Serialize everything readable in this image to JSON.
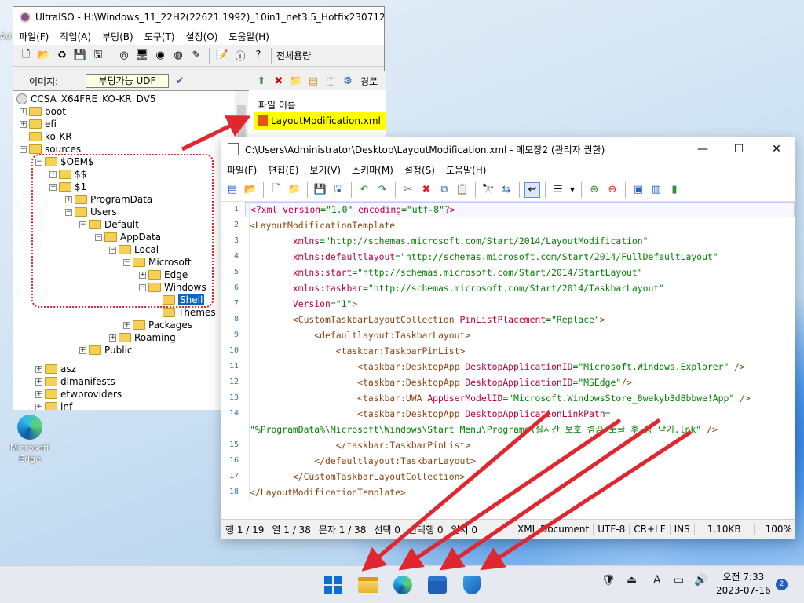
{
  "desktop": {
    "fragment": "Ad",
    "edge_icon_label": "Microsoft Edge"
  },
  "ultraiso": {
    "title": "UltraISO - H:\\Windows_11_22H2(22621.1992)_10in1_net3.5_Hotfix230712_Laun",
    "menu": [
      "파일(F)",
      "작업(A)",
      "부팅(B)",
      "도구(T)",
      "설정(O)",
      "도움말(H)"
    ],
    "toolbar_tail": "전체용량",
    "image_label": "이미지:",
    "image_type": "부팅가능 UDF",
    "right_header_label": "경로",
    "filename_header": "파일 이름",
    "selected_file": "LayoutModification.xml",
    "tree": [
      {
        "label": "CCSA_X64FRE_KO-KR_DV5",
        "icon": "cd"
      },
      {
        "label": "boot"
      },
      {
        "label": "efi"
      },
      {
        "label": "ko-KR"
      },
      {
        "label": "sources"
      },
      {
        "label": "$OEM$"
      },
      {
        "label": "$$"
      },
      {
        "label": "$1"
      },
      {
        "label": "ProgramData"
      },
      {
        "label": "Users"
      },
      {
        "label": "Default"
      },
      {
        "label": "AppData"
      },
      {
        "label": "Local"
      },
      {
        "label": "Microsoft"
      },
      {
        "label": "Edge"
      },
      {
        "label": "Windows"
      },
      {
        "label": "Shell"
      },
      {
        "label": "Themes"
      },
      {
        "label": "Packages"
      },
      {
        "label": "Roaming"
      },
      {
        "label": "Public"
      },
      {
        "label": "asz"
      },
      {
        "label": "dlmanifests"
      },
      {
        "label": "etwproviders"
      },
      {
        "label": "inf"
      }
    ]
  },
  "notepad": {
    "title": "C:\\Users\\Administrator\\Desktop\\LayoutModification.xml - 메모장2 (관리자 권한)",
    "menu": [
      "파일(F)",
      "편집(E)",
      "보기(V)",
      "스키마(M)",
      "설정(S)",
      "도움말(H)"
    ],
    "line_numbers": [
      "1",
      "2",
      "3",
      "4",
      "5",
      "6",
      "7",
      "8",
      "9",
      "10",
      "11",
      "12",
      "13",
      "14",
      "15",
      "16",
      "17",
      "18"
    ],
    "code": {
      "l1": {
        "a": "<?xml ",
        "b": "version",
        "c": "=\"1.0\" ",
        "d": "encoding",
        "e": "=\"utf-8\"",
        "f": "?>"
      },
      "l2": "<LayoutModificationTemplate",
      "l3": {
        "a": "        xmlns",
        "b": "=\"http://schemas.microsoft.com/Start/2014/LayoutModification\""
      },
      "l4": {
        "a": "        xmlns:defaultlayout",
        "b": "=\"http://schemas.microsoft.com/Start/2014/FullDefaultLayout\""
      },
      "l5": {
        "a": "        xmlns:start",
        "b": "=\"http://schemas.microsoft.com/Start/2014/StartLayout\""
      },
      "l6": {
        "a": "        xmlns:taskbar",
        "b": "=\"http://schemas.microsoft.com/Start/2014/TaskbarLayout\""
      },
      "l7": {
        "a": "        Version",
        "b": "=\"1\"",
        "c": ">"
      },
      "l8": {
        "a": "        <CustomTaskbarLayoutCollection ",
        "b": "PinListPlacement",
        "c": "=\"Replace\"",
        "d": ">"
      },
      "l9": "            <defaultlayout:TaskbarLayout>",
      "l10": "                <taskbar:TaskbarPinList>",
      "l11": {
        "a": "                    <taskbar:DesktopApp ",
        "b": "DesktopApplicationID",
        "c": "=\"Microsoft.Windows.Explorer\" ",
        "d": "/>"
      },
      "l12": {
        "a": "                    <taskbar:DesktopApp ",
        "b": "DesktopApplicationID",
        "c": "=\"MSEdge\"",
        "d": "/>"
      },
      "l13": {
        "a": "                    <taskbar:UWA ",
        "b": "AppUserModelID",
        "c": "=\"Microsoft.WindowsStore_8wekyb3d8bbwe!App\" ",
        "d": "/>"
      },
      "l14": {
        "a": "                    <taskbar:DesktopApp ",
        "b": "DesktopApplicationLinkPath",
        "c": "="
      },
      "l14b": {
        "a": "\"%ProgramData%\\Microsoft\\Windows\\Start Menu\\Programs\\실시간 보호 켬끔 토글 후 창 닫기.lnk\" ",
        "b": "/>"
      },
      "l15": "                </taskbar:TaskbarPinList>",
      "l16": "            </defaultlayout:TaskbarLayout>",
      "l17": "        </CustomTaskbarLayoutCollection>",
      "l18": "</LayoutModificationTemplate>"
    },
    "status": {
      "line": "행 1 / 19",
      "col": "열 1 / 38",
      "chars": "문자 1 / 38",
      "sel": "선택 0",
      "sel_lines": "선택행 0",
      "match": "일치 0",
      "schema": "XML Document",
      "encoding": "UTF-8",
      "eol": "CR+LF",
      "ins": "INS",
      "size": "1.10KB",
      "zoom": "100%"
    }
  },
  "taskbar": {
    "clock_time": "오전 7:33",
    "clock_date": "2023-07-16",
    "notification_count": "2",
    "ime": "A"
  },
  "colors": {
    "annotation_red": "#e0262f",
    "highlight_yellow": "#ffff00",
    "selection_blue": "#0a64ca"
  }
}
